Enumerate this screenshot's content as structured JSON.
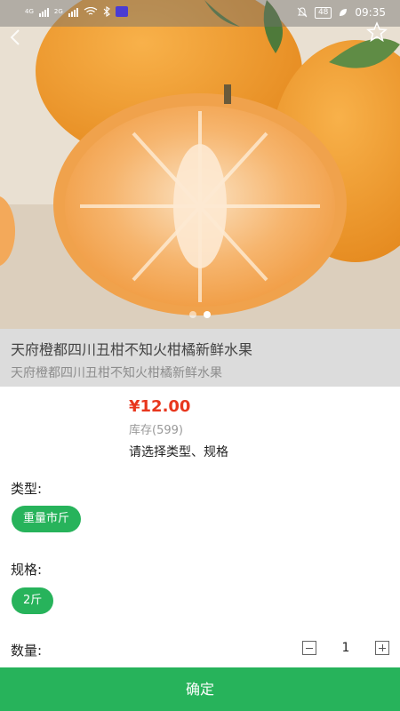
{
  "status_bar": {
    "network_1": "4G",
    "network_2": "2G",
    "battery": "48",
    "time": "09:35"
  },
  "gallery": {
    "image_icon": "orange-photo",
    "dots": 2,
    "active_dot": 2
  },
  "product": {
    "title": "天府橙都四川丑柑不知火柑橘新鲜水果",
    "subtitle": "天府橙都四川丑柑不知火柑橘新鲜水果"
  },
  "sku": {
    "price": "¥12.00",
    "stock": "库存(599)",
    "hint": "请选择类型、规格",
    "type_label": "类型:",
    "type_option": "重量市斤",
    "spec_label": "规格:",
    "spec_option": "2斤",
    "qty_label": "数量:",
    "qty_value": "1"
  },
  "actions": {
    "confirm": "确定"
  },
  "colors": {
    "accent": "#27b35b",
    "price": "#e8371e"
  }
}
